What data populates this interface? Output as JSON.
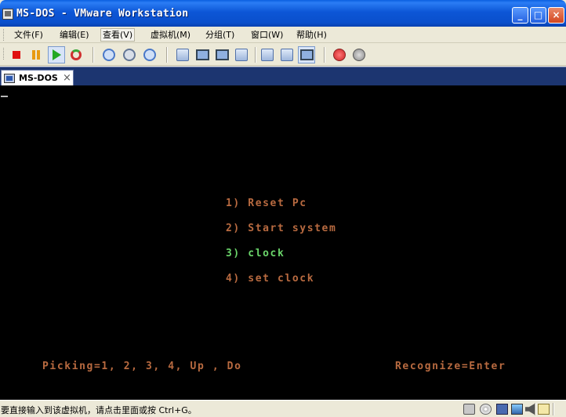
{
  "window": {
    "title": "MS-DOS - VMware Workstation",
    "controls": {
      "minimize": "_",
      "maximize": "□",
      "close": "×"
    }
  },
  "menu": {
    "items": [
      {
        "label": "文件(F)"
      },
      {
        "label": "编辑(E)"
      },
      {
        "label": "查看(V)"
      },
      {
        "label": "虚拟机(M)"
      },
      {
        "label": "分组(T)"
      },
      {
        "label": "窗口(W)"
      },
      {
        "label": "帮助(H)"
      }
    ]
  },
  "toolbar": {
    "buttons": [
      "stop-icon",
      "pause-icon",
      "play-icon",
      "reset-icon",
      "snapshot-take-icon",
      "snapshot-revert-icon",
      "snapshot-manager-icon",
      "quick-switch-icon",
      "full-screen-icon",
      "fit-window-icon",
      "unity-icon",
      "summary-icon",
      "console-icon",
      "console-view-icon",
      "record-icon",
      "replay-icon"
    ]
  },
  "tabs": [
    {
      "label": "MS-DOS",
      "close": "×"
    }
  ],
  "console": {
    "menu": [
      {
        "text": "1) Reset Pc",
        "highlighted": false
      },
      {
        "text": "2) Start system",
        "highlighted": false
      },
      {
        "text": "3) clock",
        "highlighted": true
      },
      {
        "text": "4) set clock",
        "highlighted": false
      }
    ],
    "footer_left": "Picking=1, 2, 3, 4, Up , Do",
    "footer_right": "Recognize=Enter",
    "colors": {
      "normal": "#b86a40",
      "highlight": "#6ad46a",
      "background": "#000000"
    }
  },
  "statusbar": {
    "message": "要直接输入到该虚拟机，请点击里面或按 Ctrl+G。",
    "devices": [
      "hard-disk-icon",
      "cd-rom-icon",
      "floppy-icon",
      "network-icon",
      "sound-icon",
      "message-log-icon"
    ]
  }
}
